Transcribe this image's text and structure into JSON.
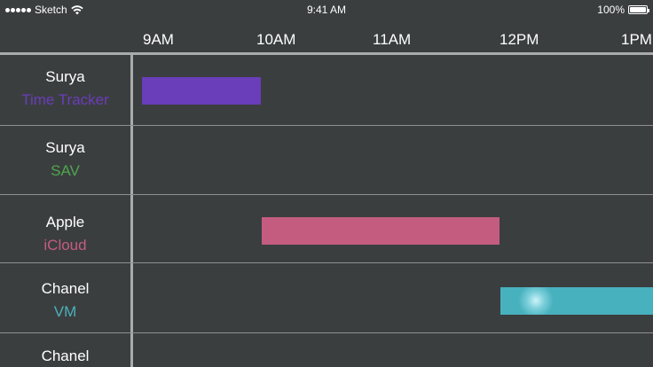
{
  "status_bar": {
    "carrier": "Sketch",
    "time": "9:41 AM",
    "battery": "100%"
  },
  "timeline": {
    "hours": [
      "9AM",
      "10AM",
      "11AM",
      "12PM",
      "1PM"
    ]
  },
  "rows": [
    {
      "client": "Surya",
      "project": "Time Tracker",
      "color": "#6a3dba",
      "start": "9:00",
      "end": "10:00"
    },
    {
      "client": "Surya",
      "project": "SAV",
      "color": "#4ea64e",
      "start": null,
      "end": null
    },
    {
      "client": "Apple",
      "project": "iCloud",
      "color": "#c45c80",
      "start": "10:00",
      "end": "12:00"
    },
    {
      "client": "Chanel",
      "project": "VM",
      "color": "#48b1be",
      "start": "12:00",
      "end": "13:30"
    },
    {
      "client": "Chanel",
      "project": "",
      "color": "#48b1be",
      "start": null,
      "end": null
    }
  ]
}
